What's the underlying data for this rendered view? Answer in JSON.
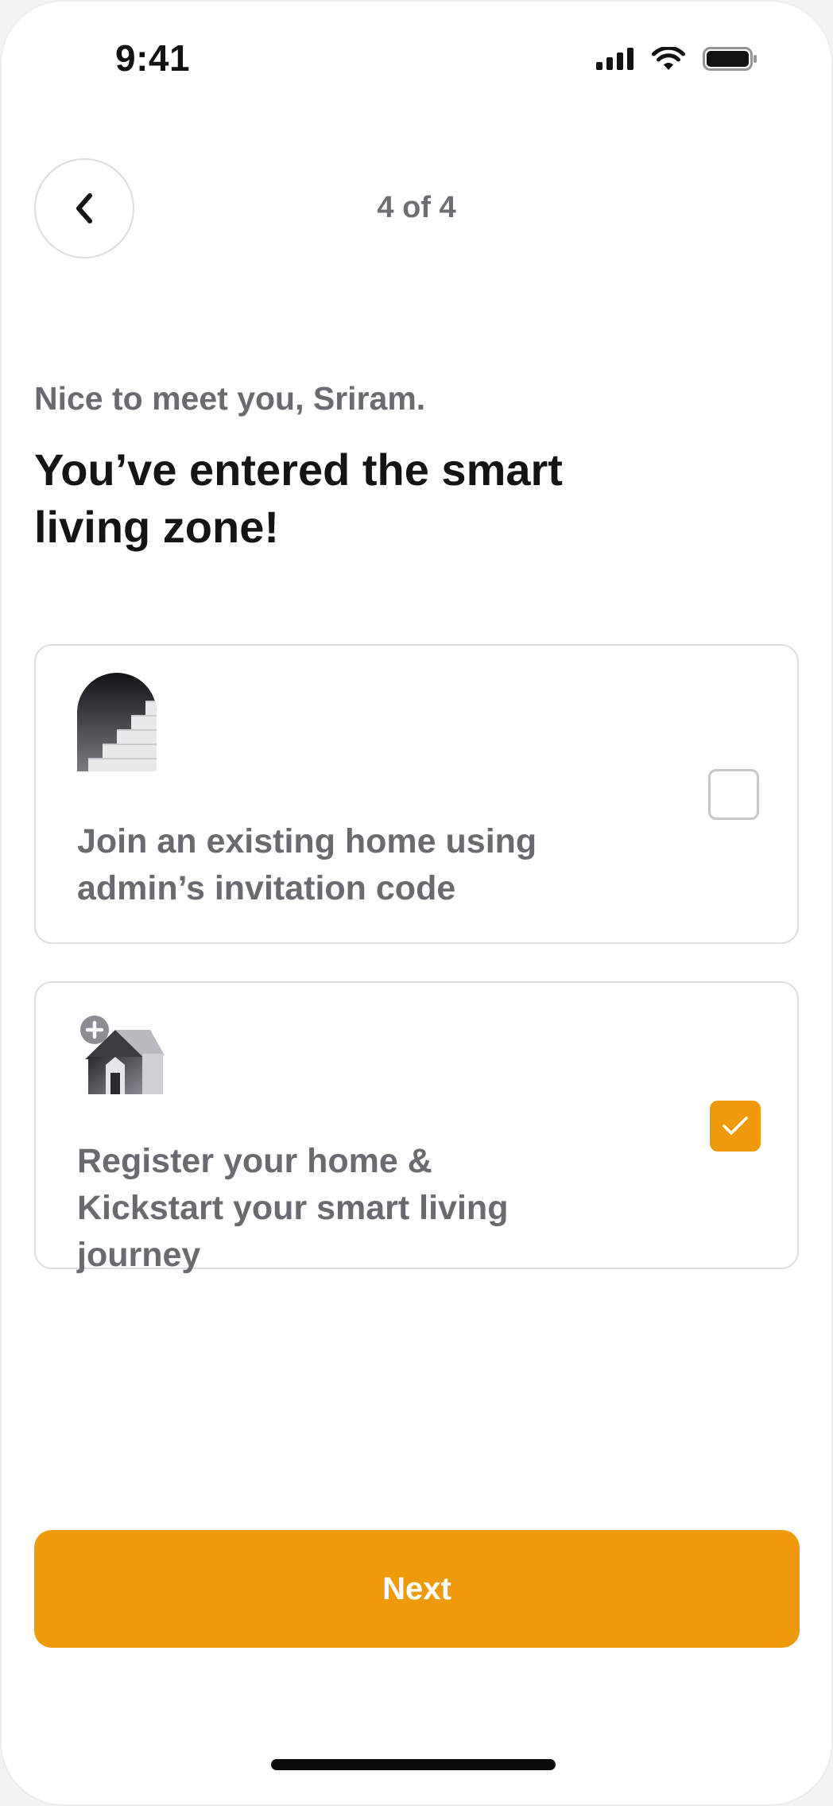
{
  "status_bar": {
    "time": "9:41"
  },
  "header": {
    "step": "4 of 4",
    "back_icon": "chevron-left-icon"
  },
  "greeting": "Nice to meet you, Sriram.",
  "headline": "You’ve entered the smart living zone!",
  "options": [
    {
      "icon": "stairs-arch-icon",
      "label": "Join an existing home using admin’s invitation code",
      "checked": false
    },
    {
      "icon": "add-home-icon",
      "label": "Register your home & Kickstart your smart living journey",
      "checked": true
    }
  ],
  "next_label": "Next",
  "colors": {
    "accent": "#ef9a0b",
    "text_primary": "#141417",
    "text_secondary": "#6a6a70",
    "border": "#dedee1"
  }
}
